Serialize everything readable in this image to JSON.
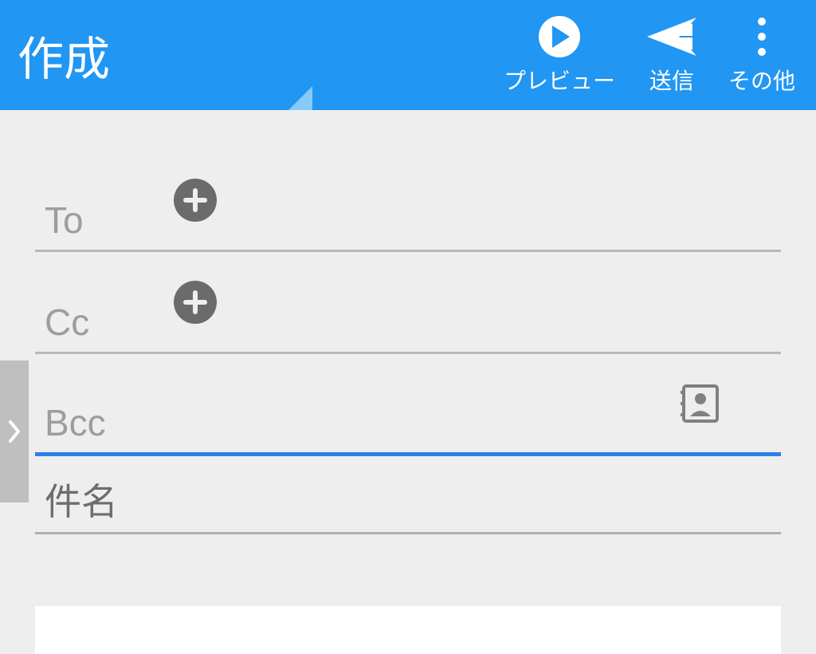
{
  "header": {
    "title": "作成",
    "actions": {
      "preview": "プレビュー",
      "send": "送信",
      "more": "その他"
    }
  },
  "fields": {
    "to_label": "To",
    "cc_label": "Cc",
    "bcc_label": "Bcc",
    "subject_label": "件名"
  }
}
